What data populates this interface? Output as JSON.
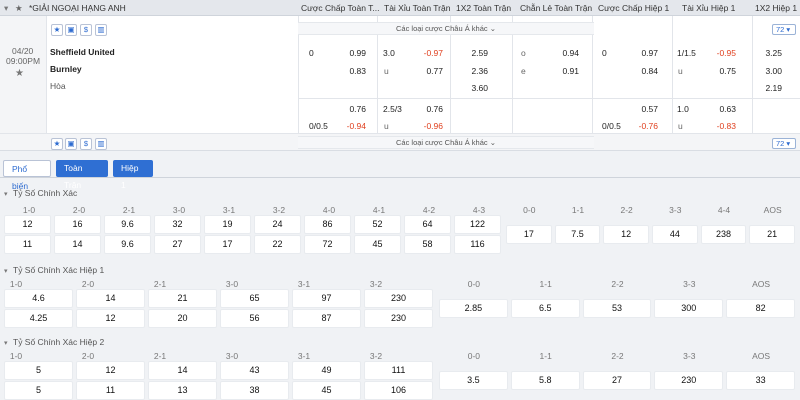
{
  "header": {
    "league": "*GIẢI NGOẠI HẠNG ANH",
    "cols": [
      "Cược Chấp Toàn T...",
      "Tài Xỉu Toàn Trận",
      "1X2 Toàn Trận",
      "Chẵn Lẻ Toàn Trận",
      "Cược Chấp Hiệp 1",
      "Tài Xỉu Hiệp 1",
      "1X2 Hiệp 1"
    ]
  },
  "match": {
    "date": "04/20",
    "time": "09:00PM",
    "home": "Sheffield United",
    "away": "Burnley",
    "draw": "Hòa"
  },
  "line1": {
    "hdp_line": "0",
    "hdp_home": "0.99",
    "hdp_away": "0.83",
    "ou_line": "3.0",
    "ou_over": "-0.97",
    "ou_u": "u",
    "ou_under": "0.77",
    "x12_home": "2.59",
    "x12_away": "2.36",
    "x12_draw": "3.60",
    "oe_o": "o",
    "oe_odd": "0.94",
    "oe_e": "e",
    "oe_even": "0.91",
    "h1_hdp_line": "0",
    "h1_hdp_home": "0.97",
    "h1_hdp_away": "0.84",
    "h1_ou_line": "1/1.5",
    "h1_ou_over": "-0.95",
    "h1_ou_u": "u",
    "h1_ou_under": "0.75",
    "h1_x12_home": "3.25",
    "h1_x12_away": "3.00",
    "h1_x12_draw": "2.19"
  },
  "line2": {
    "hdp_home": "0.76",
    "hdp_line": "0/0.5",
    "hdp_away": "-0.94",
    "ou_line": "2.5/3",
    "ou_over": "0.76",
    "ou_u": "u",
    "ou_under": "-0.96",
    "h1_hdp_home": "0.57",
    "h1_hdp_line": "0/0.5",
    "h1_hdp_away": "-0.76",
    "h1_ou_line": "1.0",
    "h1_ou_over": "0.63",
    "h1_ou_u": "u",
    "h1_ou_under": "-0.83"
  },
  "other_bets": "Các loại cược Châu Á khác",
  "count": "72",
  "tabs": [
    "Phổ biến",
    "Toàn Trận",
    "Hiệp 1"
  ],
  "sections": [
    {
      "title": "Tỷ Số Chính Xác",
      "labels1": [
        "1-0",
        "2-0",
        "2-1",
        "3-0",
        "3-1",
        "3-2",
        "4-0",
        "4-1",
        "4-2",
        "4-3"
      ],
      "row1": [
        "12",
        "16",
        "9.6",
        "32",
        "19",
        "24",
        "86",
        "52",
        "64",
        "122"
      ],
      "row2": [
        "11",
        "14",
        "9.6",
        "27",
        "17",
        "22",
        "72",
        "45",
        "58",
        "116"
      ],
      "labels2": [
        "0-0",
        "1-1",
        "2-2",
        "3-3",
        "4-4",
        "AOS"
      ],
      "row3": [
        "17",
        "7.5",
        "12",
        "44",
        "238",
        "21"
      ]
    },
    {
      "title": "Tỷ Số Chính Xác Hiệp 1",
      "labels1": [
        "1-0",
        "2-0",
        "2-1",
        "3-0",
        "3-1",
        "3-2"
      ],
      "row1": [
        "4.6",
        "14",
        "21",
        "65",
        "97",
        "230"
      ],
      "row2": [
        "4.25",
        "12",
        "20",
        "56",
        "87",
        "230"
      ],
      "labels2": [
        "0-0",
        "1-1",
        "2-2",
        "3-3",
        "AOS"
      ],
      "row3": [
        "2.85",
        "6.5",
        "53",
        "300",
        "82"
      ]
    },
    {
      "title": "Tỷ Số Chính Xác Hiệp 2",
      "labels1": [
        "1-0",
        "2-0",
        "2-1",
        "3-0",
        "3-1",
        "3-2"
      ],
      "row1": [
        "5",
        "12",
        "14",
        "43",
        "49",
        "111"
      ],
      "row2": [
        "5",
        "11",
        "13",
        "38",
        "45",
        "106"
      ],
      "labels2": [
        "0-0",
        "1-1",
        "2-2",
        "3-3",
        "AOS"
      ],
      "row3": [
        "3.5",
        "5.8",
        "27",
        "230",
        "33"
      ]
    }
  ]
}
